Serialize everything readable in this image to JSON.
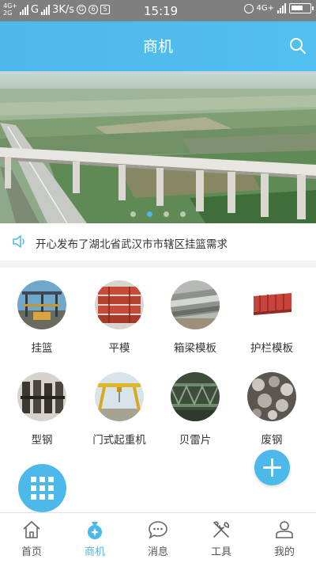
{
  "status_bar": {
    "network_top": "4G+",
    "network_bottom": "2G",
    "network2": "G",
    "speed": "3K/s",
    "icon_a": "G",
    "icon_b": "6",
    "icon_c": "5",
    "time": "15:19",
    "right_network": "4G+"
  },
  "header": {
    "title": "商机"
  },
  "banner": {
    "slide_count": 4,
    "active_index": 1
  },
  "notice": {
    "text": "开心发布了湖北省武汉市市辖区挂篮需求"
  },
  "categories": [
    {
      "label": "挂篮",
      "icon": "hanging-basket-photo"
    },
    {
      "label": "平模",
      "icon": "flat-formwork-photo"
    },
    {
      "label": "箱梁模板",
      "icon": "box-girder-formwork-photo"
    },
    {
      "label": "护栏模板",
      "icon": "guardrail-formwork-photo"
    },
    {
      "label": "型钢",
      "icon": "section-steel-photo"
    },
    {
      "label": "门式起重机",
      "icon": "gantry-crane-photo"
    },
    {
      "label": "贝雷片",
      "icon": "bailey-panel-photo"
    },
    {
      "label": "废钢",
      "icon": "scrap-steel-photo"
    }
  ],
  "tabs": [
    {
      "label": "首页",
      "icon": "home-icon"
    },
    {
      "label": "商机",
      "icon": "business-bag-icon",
      "active": true
    },
    {
      "label": "消息",
      "icon": "message-icon"
    },
    {
      "label": "工具",
      "icon": "tools-icon"
    },
    {
      "label": "我的",
      "icon": "profile-icon"
    }
  ],
  "colors": {
    "accent": "#4db8ea",
    "status_bar": "#7f7f7f"
  }
}
